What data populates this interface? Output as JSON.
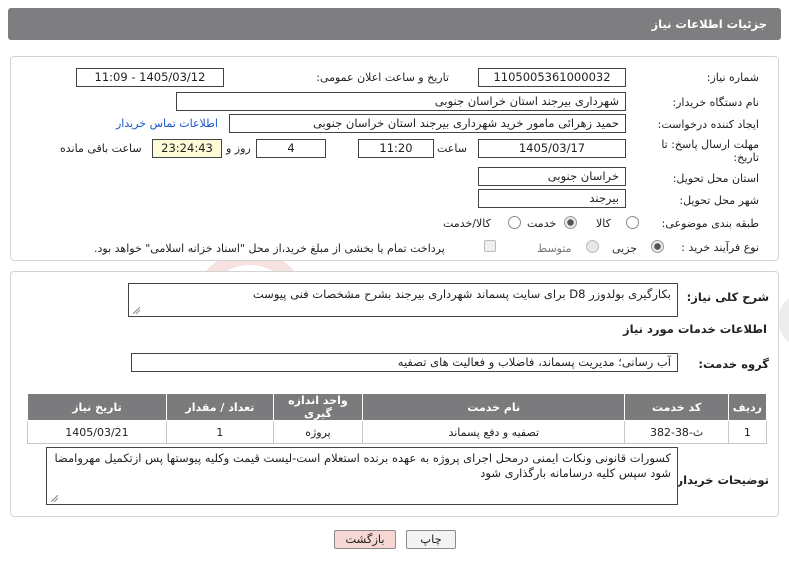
{
  "header": {
    "title": "جزئیات اطلاعات نیاز"
  },
  "need_number": {
    "label": "شماره نیاز:",
    "value": "1105005361000032"
  },
  "announce": {
    "label": "تاریخ و ساعت اعلان عمومی:",
    "value": "1405/03/12 - 11:09"
  },
  "buyer": {
    "label": "نام دستگاه خریدار:",
    "value": "شهرداری بیرجند استان خراسان جنوبی"
  },
  "creator": {
    "label": "ایجاد کننده درخواست:",
    "value": "حمید زهرائی مامور خرید شهرداری بیرجند استان خراسان جنوبی",
    "contact_link": "اطلاعات تماس خریدار"
  },
  "deadline": {
    "label_line1": "مهلت ارسال پاسخ: تا",
    "label_line2": "تاریخ:",
    "date": "1405/03/17",
    "time_label": "ساعت",
    "time": "11:20",
    "days": "4",
    "days_label": "روز و",
    "remaining": "23:24:43",
    "remaining_label": "ساعت باقی مانده"
  },
  "province": {
    "label": "استان محل تحویل:",
    "value": "خراسان جنوبی"
  },
  "city": {
    "label": "شهر محل تحویل:",
    "value": "بیرجند"
  },
  "category": {
    "label": "طبقه بندی موضوعی:",
    "options": [
      "کالا",
      "خدمت",
      "کالا/خدمت"
    ],
    "selected": "خدمت"
  },
  "process": {
    "label": "نوع فرآیند خرید :",
    "options": [
      "جزیی",
      "متوسط"
    ],
    "selected": "جزیی",
    "payment_note": "پرداخت تمام یا بخشی از مبلغ خرید،از محل \"اسناد خزانه اسلامی\" خواهد بود."
  },
  "description": {
    "label": "شرح کلی نیاز:",
    "value": "بکارگیری بولدوزر D8  برای سایت پسماند شهرداری بیرجند بشرح مشخصات فنی پیوست"
  },
  "services": {
    "section_title": "اطلاعات خدمات مورد نیاز",
    "group_label": "گروه خدمت:",
    "group_value": "آب رسانی؛ مدیریت پسماند، فاضلاب و فعالیت های تصفیه"
  },
  "table": {
    "headers": [
      "ردیف",
      "کد خدمت",
      "نام خدمت",
      "واحد اندازه گیری",
      "تعداد / مقدار",
      "تاریخ نیاز"
    ],
    "rows": [
      [
        "1",
        "ث-38-382",
        "تصفیه و دفع پسماند",
        "پروژه",
        "1",
        "1405/03/21"
      ]
    ]
  },
  "buyer_notes": {
    "label": "توضیحات خریدار:",
    "value": "کسورات قانونی ونکات ایمنی درمحل اجرای پروژه به عهده برنده استعلام است-لیست قیمت وکلیه پیوستها پس ازتکمیل مهروامضا شود سپس کلیه درسامانه بارگذاری شود"
  },
  "buttons": {
    "print": "چاپ",
    "back": "بازگشت"
  },
  "watermark": {
    "text": "AriaTender.net"
  },
  "colors": {
    "header_bg": "#7e7e80",
    "table_header_bg": "#7b7b7d",
    "link": "#1a56c8",
    "back_button_bg": "#f6d7d4",
    "remaining_bg": "#fdfbd7"
  }
}
